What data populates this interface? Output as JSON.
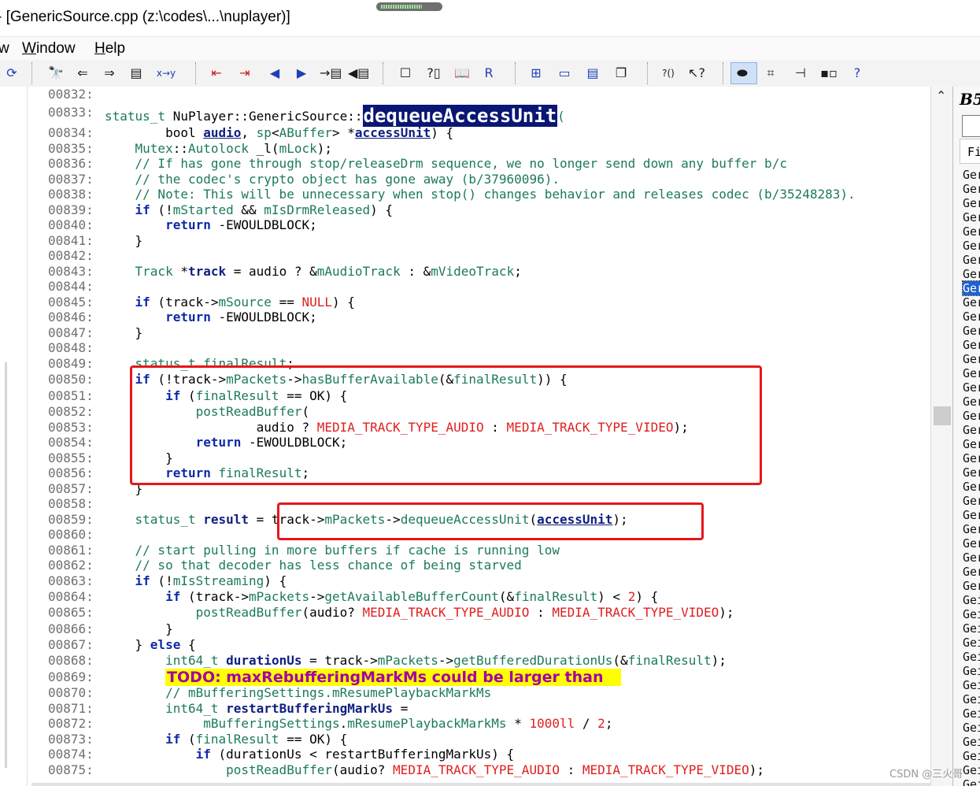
{
  "window": {
    "title": "- [GenericSource.cpp (z:\\codes\\...\\nuplayer)]"
  },
  "menu": [
    {
      "label": "w",
      "accel": ""
    },
    {
      "label": "Window",
      "accel": "W"
    },
    {
      "label": "Help",
      "accel": "H"
    }
  ],
  "toolbar": {
    "icons": [
      {
        "name": "refresh-icon",
        "glyph": "⟳",
        "style": "blue"
      },
      {
        "name": "binoculars-icon",
        "glyph": "🔭",
        "style": ""
      },
      {
        "name": "find-previous-icon",
        "glyph": "⇐",
        "style": ""
      },
      {
        "name": "find-next-icon",
        "glyph": "⇒",
        "style": ""
      },
      {
        "name": "find-in-files-icon",
        "glyph": "▤",
        "style": ""
      },
      {
        "name": "replace-icon",
        "glyph": "x→y",
        "style": "blue"
      },
      {
        "name": "bookmark-prev-icon",
        "glyph": "⇤",
        "style": "red"
      },
      {
        "name": "bookmark-next-icon",
        "glyph": "⇥",
        "style": "red"
      },
      {
        "name": "back-arrow-icon",
        "glyph": "◀",
        "style": "blue"
      },
      {
        "name": "forward-arrow-icon",
        "glyph": "▶",
        "style": "blue"
      },
      {
        "name": "jump-to-definition-icon",
        "glyph": "→▤",
        "style": ""
      },
      {
        "name": "jump-to-caller-icon",
        "glyph": "◀▤",
        "style": ""
      },
      {
        "name": "symbol-window-icon",
        "glyph": "☐",
        "style": ""
      },
      {
        "name": "context-window-icon",
        "glyph": "?▯",
        "style": ""
      },
      {
        "name": "book-icon",
        "glyph": "📖",
        "style": ""
      },
      {
        "name": "relation-icon",
        "glyph": "R",
        "style": "blue"
      },
      {
        "name": "layout-grid-icon",
        "glyph": "⊞",
        "style": "blue"
      },
      {
        "name": "layout-horizontal-icon",
        "glyph": "▭",
        "style": "blue"
      },
      {
        "name": "layout-split-icon",
        "glyph": "▤",
        "style": "blue"
      },
      {
        "name": "cascade-windows-icon",
        "glyph": "❐",
        "style": ""
      },
      {
        "name": "parentheses-help-icon",
        "glyph": "?()",
        "style": ""
      },
      {
        "name": "pointer-help-icon",
        "glyph": "↖?",
        "style": ""
      },
      {
        "name": "toggle-view-icon",
        "glyph": "⬬",
        "style": ""
      },
      {
        "name": "overview-icon",
        "glyph": "⌗",
        "style": ""
      },
      {
        "name": "tree-icon",
        "glyph": "⊣",
        "style": ""
      },
      {
        "name": "graph-icon",
        "glyph": "▪▫",
        "style": ""
      },
      {
        "name": "help-panel-icon",
        "glyph": "?",
        "style": "blue"
      }
    ]
  },
  "editor": {
    "lines": [
      {
        "n": "00832:",
        "code": ""
      },
      {
        "n": "00833:",
        "code": "status_t NuPlayer::GenericSource::",
        "func": "dequeueAccessUnit",
        "after": "("
      },
      {
        "n": "00834:",
        "code": "        bool audio, sp<ABuffer> *accessUnit) {"
      },
      {
        "n": "00835:",
        "code": "    Mutex::Autolock _l(mLock);"
      },
      {
        "n": "00836:",
        "code": "    // If has gone through stop/releaseDrm sequence, we no longer send down any buffer b/c"
      },
      {
        "n": "00837:",
        "code": "    // the codec's crypto object has gone away (b/37960096)."
      },
      {
        "n": "00838:",
        "code": "    // Note: This will be unnecessary when stop() changes behavior and releases codec (b/35248283)."
      },
      {
        "n": "00839:",
        "code": "    if (!mStarted && mIsDrmReleased) {"
      },
      {
        "n": "00840:",
        "code": "        return -EWOULDBLOCK;"
      },
      {
        "n": "00841:",
        "code": "    }"
      },
      {
        "n": "00842:",
        "code": ""
      },
      {
        "n": "00843:",
        "code": "    Track *track = audio ? &mAudioTrack : &mVideoTrack;"
      },
      {
        "n": "00844:",
        "code": ""
      },
      {
        "n": "00845:",
        "code": "    if (track->mSource == NULL) {"
      },
      {
        "n": "00846:",
        "code": "        return -EWOULDBLOCK;"
      },
      {
        "n": "00847:",
        "code": "    }"
      },
      {
        "n": "00848:",
        "code": ""
      },
      {
        "n": "00849:",
        "code": "    status_t finalResult;"
      },
      {
        "n": "00850:",
        "code": "    if (!track->mPackets->hasBufferAvailable(&finalResult)) {"
      },
      {
        "n": "00851:",
        "code": "        if (finalResult == OK) {"
      },
      {
        "n": "00852:",
        "code": "            postReadBuffer("
      },
      {
        "n": "00853:",
        "code": "                    audio ? MEDIA_TRACK_TYPE_AUDIO : MEDIA_TRACK_TYPE_VIDEO);"
      },
      {
        "n": "00854:",
        "code": "            return -EWOULDBLOCK;"
      },
      {
        "n": "00855:",
        "code": "        }"
      },
      {
        "n": "00856:",
        "code": "        return finalResult;"
      },
      {
        "n": "00857:",
        "code": "    }"
      },
      {
        "n": "00858:",
        "code": ""
      },
      {
        "n": "00859:",
        "code": "    status_t result = track->mPackets->dequeueAccessUnit(accessUnit);"
      },
      {
        "n": "00860:",
        "code": ""
      },
      {
        "n": "00861:",
        "code": "    // start pulling in more buffers if cache is running low"
      },
      {
        "n": "00862:",
        "code": "    // so that decoder has less chance of being starved"
      },
      {
        "n": "00863:",
        "code": "    if (!mIsStreaming) {"
      },
      {
        "n": "00864:",
        "code": "        if (track->mPackets->getAvailableBufferCount(&finalResult) < 2) {"
      },
      {
        "n": "00865:",
        "code": "            postReadBuffer(audio? MEDIA_TRACK_TYPE_AUDIO : MEDIA_TRACK_TYPE_VIDEO);"
      },
      {
        "n": "00866:",
        "code": "        }"
      },
      {
        "n": "00867:",
        "code": "    } else {"
      },
      {
        "n": "00868:",
        "code": "        int64_t durationUs = track->mPackets->getBufferedDurationUs(&finalResult);"
      },
      {
        "n": "00869:",
        "code": "",
        "todo": "TODO: maxRebufferingMarkMs could be larger than"
      },
      {
        "n": "00870:",
        "code": "        // mBufferingSettings.mResumePlaybackMarkMs"
      },
      {
        "n": "00871:",
        "code": "        int64_t restartBufferingMarkUs ="
      },
      {
        "n": "00872:",
        "code": "             mBufferingSettings.mResumePlaybackMarkMs * 1000ll / 2;"
      },
      {
        "n": "00873:",
        "code": "        if (finalResult == OK) {"
      },
      {
        "n": "00874:",
        "code": "            if (durationUs < restartBufferingMarkUs) {"
      },
      {
        "n": "00875:",
        "code": "                postReadBuffer(audio? MEDIA_TRACK_TYPE_AUDIO : MEDIA_TRACK_TYPE_VIDEO);"
      }
    ]
  },
  "right_panel": {
    "header": "B5",
    "tab_label": "Fi",
    "items": [
      "Ger",
      "Ger",
      "Ger",
      "Ger",
      "Ger",
      "Ger",
      "Ger",
      "Ger",
      "Ger",
      "Ger",
      "Ger",
      "Ger",
      "Ger",
      "Ger",
      "Ger",
      "Ger",
      "Ger",
      "Ger",
      "Ger",
      "Ger",
      "Ger",
      "Ger",
      "Ger",
      "Ger",
      "Ger",
      "Ger",
      "Ger",
      "Ger",
      "Ger",
      "Ger",
      "Gei",
      "Gei",
      "Gei",
      "Gei",
      "Gei",
      "Gei",
      "Gei",
      "Gei",
      "Gei",
      "Gei",
      "Gei",
      "Gei",
      "Gei",
      "Gei"
    ],
    "selected_index": 8
  },
  "watermark": "CSDN @三火哥"
}
